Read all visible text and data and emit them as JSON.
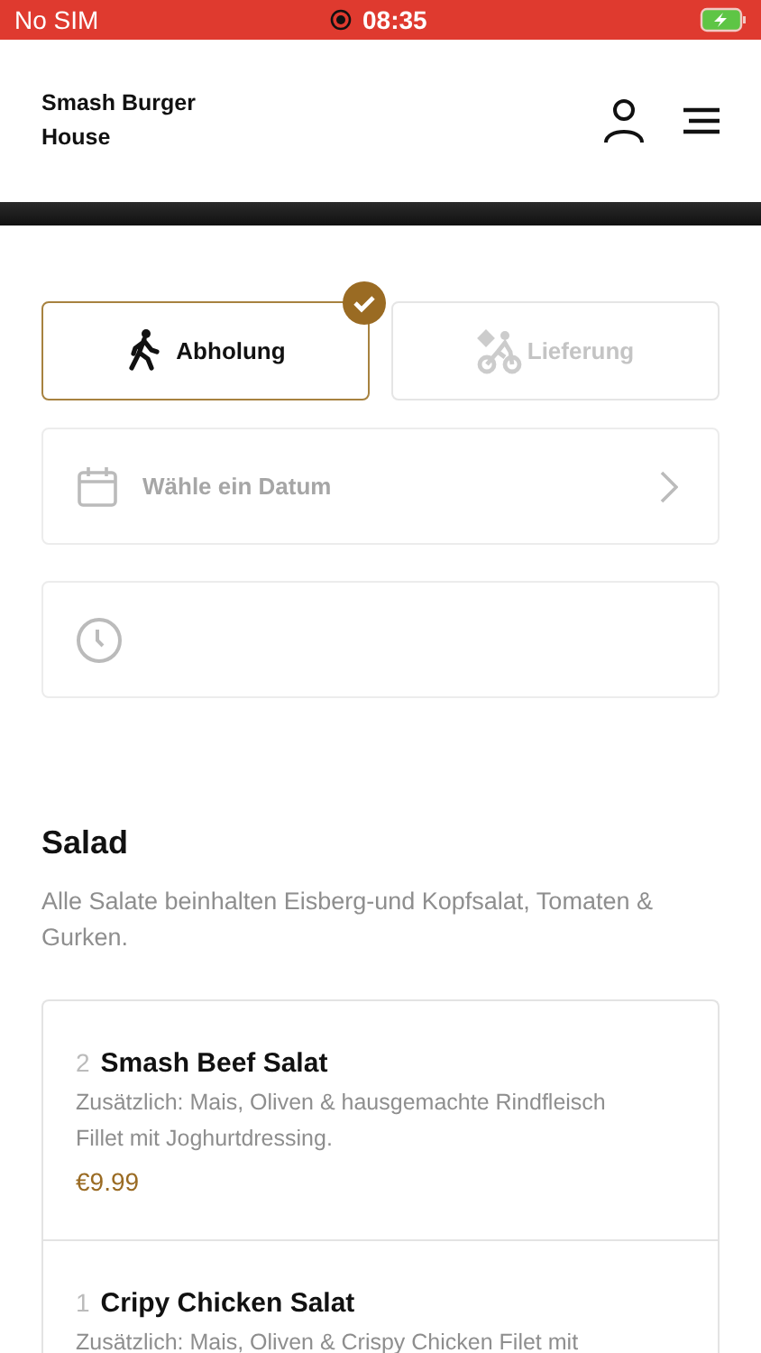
{
  "status_bar": {
    "carrier": "No SIM",
    "time": "08:35"
  },
  "header": {
    "title": "Smash Burger House"
  },
  "order_modes": [
    {
      "kind": "pickup",
      "label": "Abholung",
      "selected": true
    },
    {
      "kind": "delivery",
      "label": "Lieferung",
      "selected": false
    }
  ],
  "date_field": {
    "placeholder": "Wähle ein Datum"
  },
  "section": {
    "title": "Salad",
    "description": "Alle Salate beinhalten Eisberg-und Kopfsalat, Tomaten & Gurken.",
    "items": [
      {
        "quantity": "2",
        "name": "Smash Beef Salat",
        "description": "Zusätzlich: Mais, Oliven & hausgemachte Rindfleisch Fillet mit Joghurtdressing.",
        "price": "€9.99"
      },
      {
        "quantity": "1",
        "name": "Cripy Chicken Salat",
        "description": "Zusätzlich: Mais, Oliven & Crispy Chicken Filet mit"
      }
    ]
  }
}
